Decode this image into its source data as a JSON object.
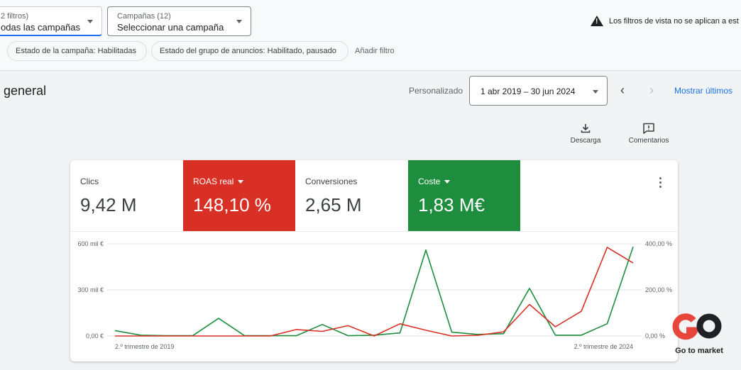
{
  "filters": {
    "view_selector": {
      "small": "2 filtros)",
      "value": "odas las campañas"
    },
    "campaign_selector": {
      "small": "Campañas (12)",
      "value": "Seleccionar una campaña"
    },
    "warning": "Los filtros de vista no se aplican a est",
    "chips": [
      "Estado de la campaña: Habilitadas",
      "Estado del grupo de anuncios: Habilitado, pausado"
    ],
    "add_filter": "Añadir filtro"
  },
  "header": {
    "title": "general",
    "date_label": "Personalizado",
    "date_range": "1 abr 2019 – 30 jun 2024",
    "show_last": "Mostrar últimos"
  },
  "tools": {
    "download": "Descarga",
    "comments": "Comentarios"
  },
  "metrics": [
    {
      "label": "Clics",
      "value": "9,42 M",
      "color": ""
    },
    {
      "label": "ROAS real",
      "value": "148,10 %",
      "color": "#d93025"
    },
    {
      "label": "Conversiones",
      "value": "2,65 M",
      "color": ""
    },
    {
      "label": "Coste",
      "value": "1,83 M€",
      "color": "#1e8e3e"
    }
  ],
  "watermark": {
    "text": "Go to market",
    "logo_text": "Go to market",
    "colors": {
      "red": "#e8453c",
      "gray": "#5f6368"
    }
  },
  "chart_data": {
    "type": "line",
    "x": [
      "2.º trimestre de 2019",
      "",
      "",
      "",
      "",
      "",
      "",
      "",
      "",
      "",
      "",
      "",
      "",
      "",
      "",
      "",
      "",
      "",
      "",
      "",
      "2.º trimestre de 2024"
    ],
    "x_tick_labels": [
      "2.º trimestre de 2019",
      "2.º trimestre de 2024"
    ],
    "left_axis": {
      "ticks": [
        "600 mil €",
        "300 mil €",
        "0,00 €"
      ],
      "ylim": [
        0,
        600
      ]
    },
    "right_axis": {
      "ticks": [
        "400,00 %",
        "200,00 %",
        "0,00 %"
      ],
      "ylim": [
        0,
        400
      ]
    },
    "series": [
      {
        "name": "Coste",
        "color": "#1e8e3e",
        "axis": "left",
        "values": [
          35,
          5,
          2,
          2,
          115,
          2,
          2,
          2,
          75,
          2,
          5,
          20,
          560,
          25,
          10,
          15,
          310,
          5,
          5,
          80,
          580
        ]
      },
      {
        "name": "ROAS real",
        "color": "#d93025",
        "axis": "right",
        "values": [
          0,
          0,
          0,
          0,
          0,
          0,
          0,
          28,
          20,
          45,
          0,
          53,
          25,
          0,
          3,
          18,
          137,
          40,
          107,
          385,
          317
        ]
      }
    ],
    "grid": true
  }
}
